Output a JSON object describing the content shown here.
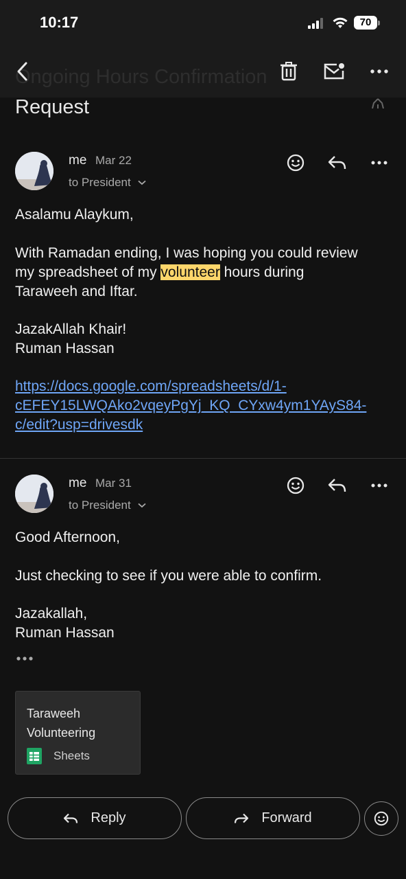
{
  "status_bar": {
    "time": "10:17",
    "battery": "70"
  },
  "header": {
    "ghost_title": "Ongoing Hours Confirmation",
    "subject": "Request"
  },
  "messages": [
    {
      "sender": "me",
      "date": "Mar 22",
      "recipient": "to President",
      "lines": {
        "greeting": "Asalamu Alaykum,",
        "line1": "With Ramadan ending, I was hoping you could review",
        "line2_pre": "my spreadsheet of my ",
        "line2_highlight": "volunteer",
        "line2_post": " hours during",
        "line3": "Taraweeh and Iftar.",
        "signoff": "JazakAllah Khair!",
        "name": "Ruman Hassan",
        "link1": "https://docs.google.com/spreadsheets/d/1-",
        "link2": "cEFEY15LWQAko2vqeyPgYj_KQ_CYxw4ym1YAyS84-",
        "link3": "c/edit?usp=drivesdk"
      }
    },
    {
      "sender": "me",
      "date": "Mar 31",
      "recipient": "to President",
      "lines": {
        "greeting": "Good Afternoon,",
        "line1": "Just checking to see if you were able to confirm.",
        "signoff": "Jazakallah,",
        "name": "Ruman Hassan"
      },
      "attachment": {
        "name": "Taraweeh Volunteering",
        "type": "Sheets"
      }
    }
  ],
  "actions": {
    "reply": "Reply",
    "forward": "Forward"
  },
  "colors": {
    "background": "#121212",
    "highlight": "#fdd66b",
    "link": "#6fa6f7",
    "sheets_green": "#1fa463"
  },
  "icons": [
    "back-icon",
    "trash-icon",
    "mark-unread-icon",
    "more-icon",
    "star-icon",
    "emoji-icon",
    "reply-icon",
    "forward-icon",
    "sheets-icon",
    "chevron-down-icon"
  ]
}
